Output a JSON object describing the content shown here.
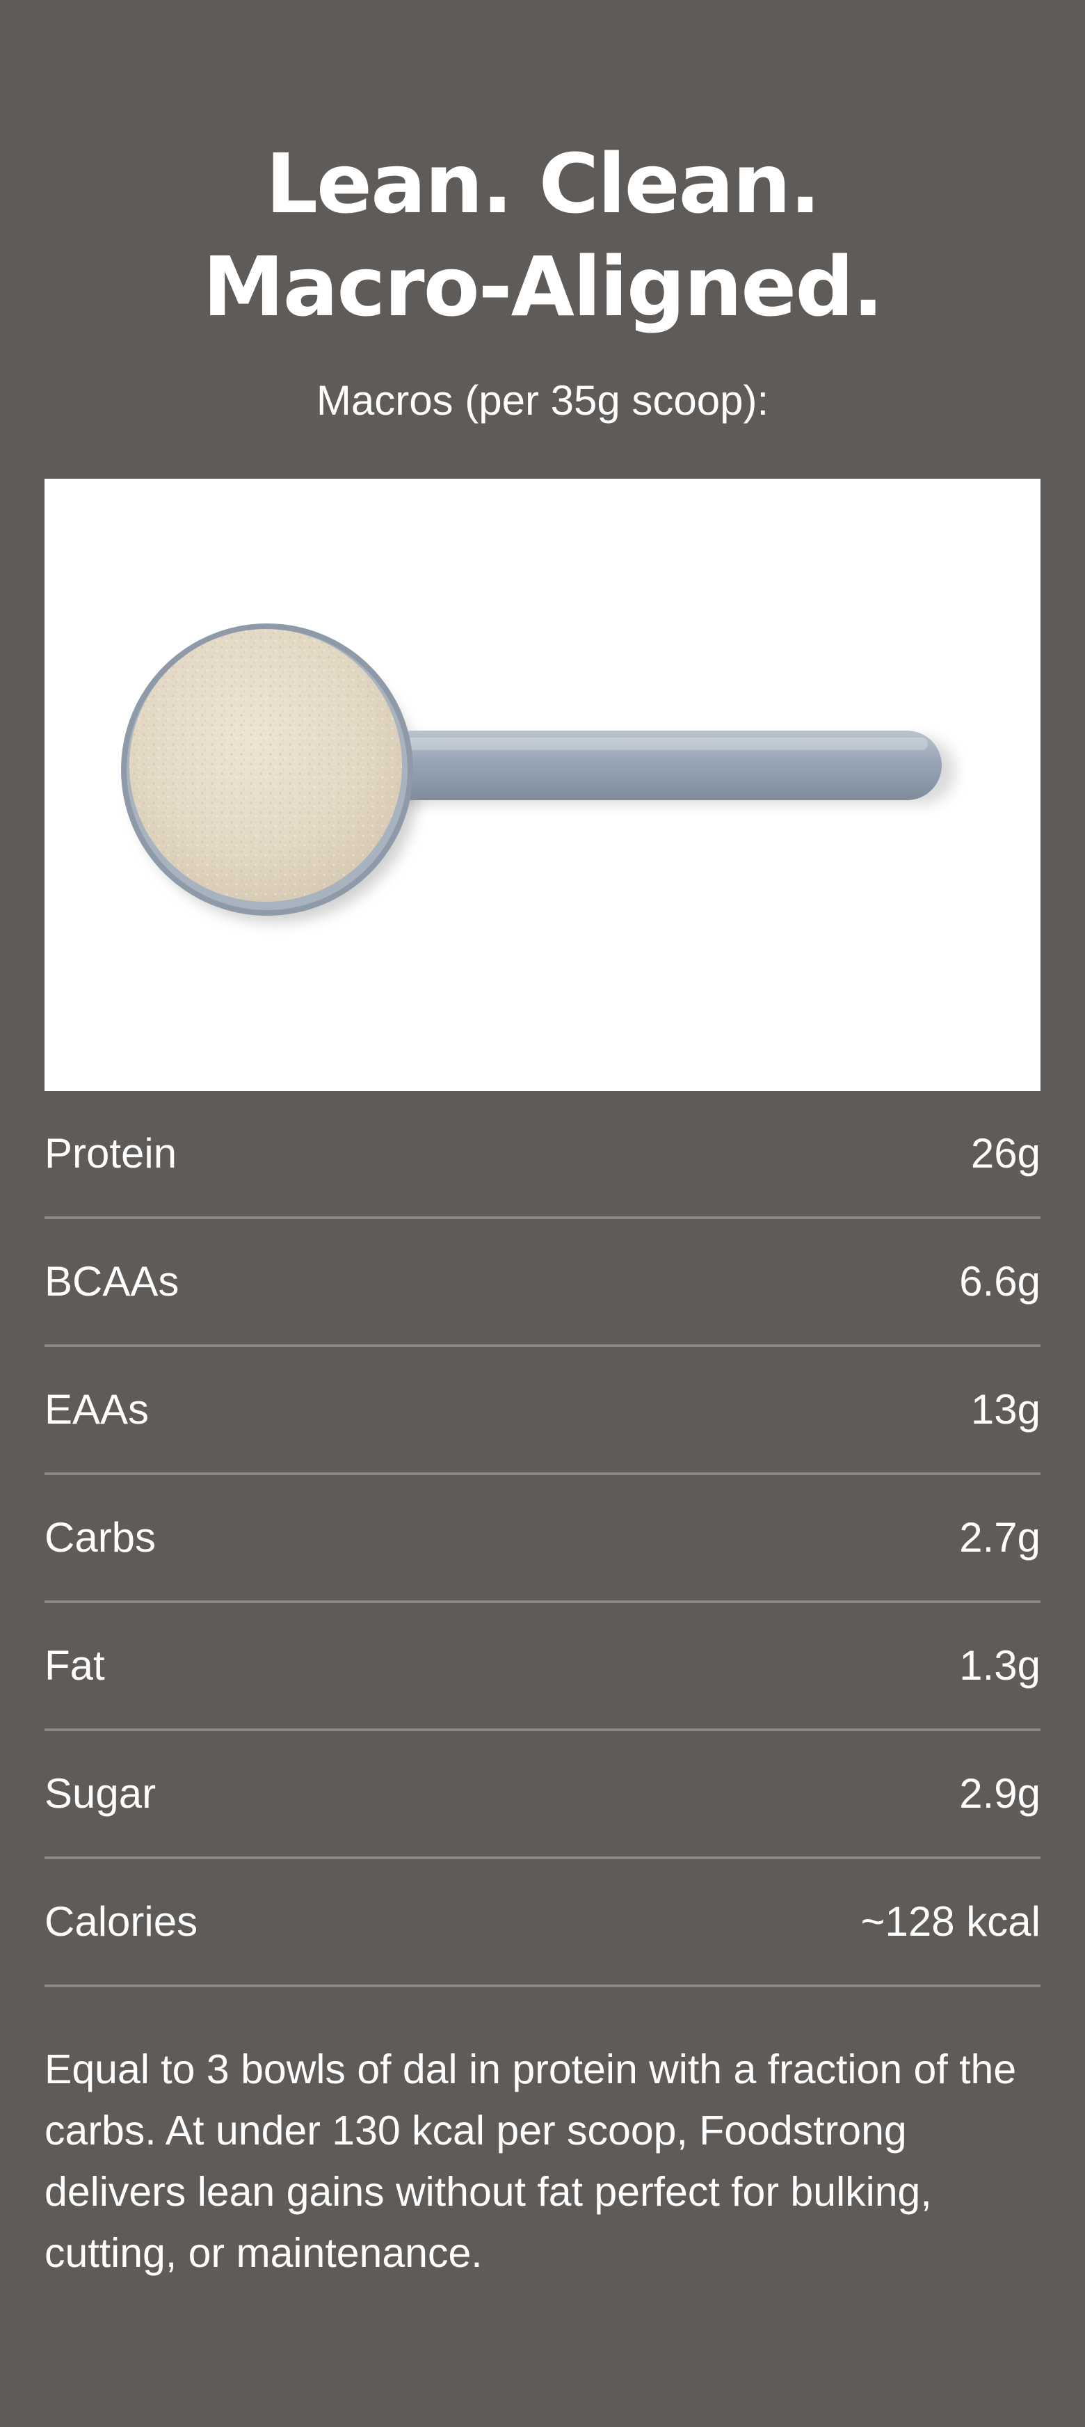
{
  "heading": {
    "line1": "Lean. Clean.",
    "line2": "Macro-Aligned."
  },
  "subheading": "Macros (per 35g scoop):",
  "image": {
    "icon": "protein-scoop-image"
  },
  "macros": [
    {
      "label": "Protein",
      "value": "26g"
    },
    {
      "label": "BCAAs",
      "value": "6.6g"
    },
    {
      "label": "EAAs",
      "value": "13g"
    },
    {
      "label": "Carbs",
      "value": "2.7g"
    },
    {
      "label": "Fat",
      "value": "1.3g"
    },
    {
      "label": "Sugar",
      "value": "2.9g"
    },
    {
      "label": "Calories",
      "value": "~128 kcal"
    }
  ],
  "description": "Equal to 3 bowls of dal in protein with a fraction of the carbs. At under 130 kcal per scoop, Foodstrong delivers lean gains without fat perfect for bulking, cutting, or maintenance.",
  "colors": {
    "background": "#5e5b58",
    "divider": "#8a8784",
    "text": "#ffffff",
    "powder": "#e6dccb",
    "scoop": "#9aa6b4"
  }
}
